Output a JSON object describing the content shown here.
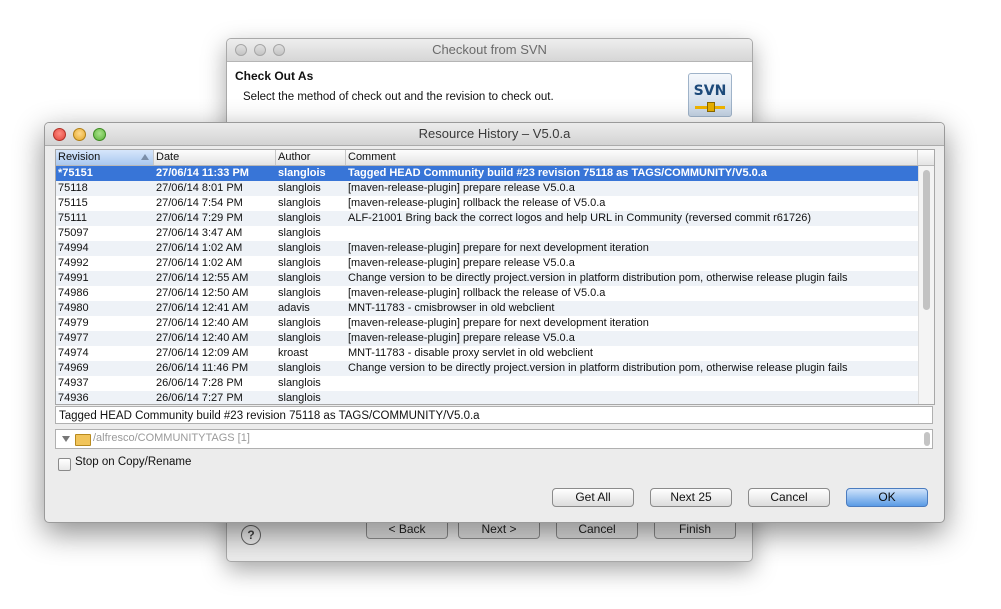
{
  "back_window": {
    "title": "Checkout from SVN",
    "header_title": "Check Out As",
    "header_desc": "Select the method of check out and the revision to check out.",
    "logo_text": "SVN",
    "buttons": {
      "back": "< Back",
      "next": "Next >",
      "cancel": "Cancel",
      "finish": "Finish"
    },
    "help": "?"
  },
  "dialog": {
    "title": "Resource History – V5.0.a",
    "columns": [
      "Revision",
      "Date",
      "Author",
      "Comment"
    ],
    "sorted_column": "Revision",
    "rows": [
      {
        "rev": "*75151",
        "date": "27/06/14 11:33 PM",
        "author": "slanglois",
        "comment": "Tagged HEAD Community build #23 revision 75118 as TAGS/COMMUNITY/V5.0.a"
      },
      {
        "rev": "75118",
        "date": "27/06/14 8:01 PM",
        "author": "slanglois",
        "comment": "[maven-release-plugin] prepare release V5.0.a"
      },
      {
        "rev": "75115",
        "date": "27/06/14 7:54 PM",
        "author": "slanglois",
        "comment": "[maven-release-plugin] rollback the release of V5.0.a"
      },
      {
        "rev": "75111",
        "date": "27/06/14 7:29 PM",
        "author": "slanglois",
        "comment": "ALF-21001 Bring back the correct logos and help URL in Community (reversed commit r61726)"
      },
      {
        "rev": "75097",
        "date": "27/06/14 3:47 AM",
        "author": "slanglois",
        "comment": ""
      },
      {
        "rev": "74994",
        "date": "27/06/14 1:02 AM",
        "author": "slanglois",
        "comment": "[maven-release-plugin] prepare for next development iteration"
      },
      {
        "rev": "74992",
        "date": "27/06/14 1:02 AM",
        "author": "slanglois",
        "comment": "[maven-release-plugin] prepare release V5.0.a"
      },
      {
        "rev": "74991",
        "date": "27/06/14 12:55 AM",
        "author": "slanglois",
        "comment": "Change version to be directly project.version in platform distribution pom, otherwise release plugin fails"
      },
      {
        "rev": "74986",
        "date": "27/06/14 12:50 AM",
        "author": "slanglois",
        "comment": "[maven-release-plugin] rollback the release of V5.0.a"
      },
      {
        "rev": "74980",
        "date": "27/06/14 12:41 AM",
        "author": "adavis",
        "comment": "MNT-11783 - cmisbrowser in old webclient"
      },
      {
        "rev": "74979",
        "date": "27/06/14 12:40 AM",
        "author": "slanglois",
        "comment": "[maven-release-plugin] prepare for next development iteration"
      },
      {
        "rev": "74977",
        "date": "27/06/14 12:40 AM",
        "author": "slanglois",
        "comment": "[maven-release-plugin] prepare release V5.0.a"
      },
      {
        "rev": "74974",
        "date": "27/06/14 12:09 AM",
        "author": "kroast",
        "comment": "MNT-11783 - disable proxy servlet in old webclient"
      },
      {
        "rev": "74969",
        "date": "26/06/14 11:46 PM",
        "author": "slanglois",
        "comment": "Change version to be directly project.version in platform distribution pom, otherwise release plugin fails"
      },
      {
        "rev": "74937",
        "date": "26/06/14 7:28 PM",
        "author": "slanglois",
        "comment": ""
      },
      {
        "rev": "74936",
        "date": "26/06/14 7:27 PM",
        "author": "slanglois",
        "comment": ""
      }
    ],
    "selected_row": 0,
    "comment_detail": "Tagged HEAD Community build #23 revision 75118 as TAGS/COMMUNITY/V5.0.a",
    "changed_path": "/alfresco/COMMUNITYTAGS [1]",
    "stop_on_copy_label": "Stop on Copy/Rename",
    "stop_on_copy_checked": false,
    "buttons": {
      "get_all": "Get All",
      "next25": "Next 25",
      "cancel": "Cancel",
      "ok": "OK"
    }
  },
  "colors": {
    "selection": "#3875d7",
    "default_button": "#5a9be5"
  }
}
